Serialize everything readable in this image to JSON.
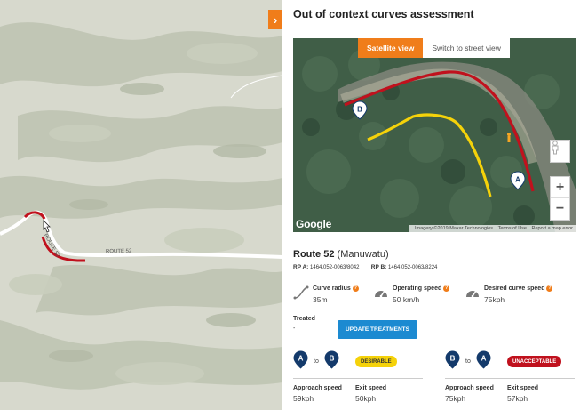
{
  "map": {
    "road_label": "ROUTE 52",
    "expand_icon": "chevron-right-icon",
    "expand_glyph": "›"
  },
  "panel": {
    "title": "Out of context curves assessment",
    "satellite": {
      "btn_satellite": "Satellite view",
      "btn_street": "Switch to street view",
      "marker_a": "A",
      "marker_b": "B",
      "google": "Google",
      "footer_imagery": "Imagery ©2019 Maxar Technologies",
      "footer_terms": "Terms of Use",
      "footer_report": "Report a map error",
      "zoom_in": "+",
      "zoom_out": "−"
    },
    "route": {
      "name": "Route 52",
      "region": "(Manuwatu)",
      "rp_a_label": "RP A:",
      "rp_a_value": "1464,052-0063/8042",
      "rp_b_label": "RP B:",
      "rp_b_value": "1464,052-0063/8224"
    },
    "metrics": [
      {
        "label": "Curve radius",
        "value": "35m",
        "icon": "curve-icon"
      },
      {
        "label": "Operating speed",
        "value": "50 km/h",
        "icon": "speedometer-icon"
      },
      {
        "label": "Desired curve speed",
        "value": "75kph",
        "icon": "speedometer-icon"
      }
    ],
    "help_glyph": "?",
    "treated_label": "Treated",
    "treated_value": "-",
    "update_button": "UPDATE TREATMENTS",
    "directions": [
      {
        "from": "A",
        "to_word": "to",
        "to": "B",
        "badge": "DESIRABLE",
        "badge_color": "#f5d20a",
        "approach_label": "Approach speed",
        "approach_value": "59kph",
        "exit_label": "Exit speed",
        "exit_value": "50kph"
      },
      {
        "from": "B",
        "to_word": "to",
        "to": "A",
        "badge": "UNACCEPTABLE",
        "badge_color": "#c0111d",
        "approach_label": "Approach speed",
        "approach_value": "75kph",
        "exit_label": "Exit speed",
        "exit_value": "57kph"
      }
    ]
  },
  "colors": {
    "accent": "#f07d1a",
    "button_blue": "#1c8ad1",
    "curve_red": "#c0111d",
    "curve_yellow": "#f5d20a",
    "pin_navy": "#143a6b"
  }
}
